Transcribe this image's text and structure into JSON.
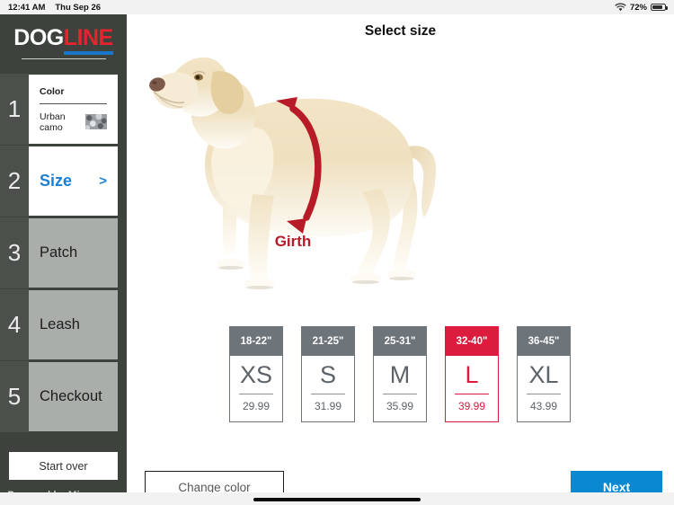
{
  "statusbar": {
    "time": "12:41 AM",
    "date": "Thu Sep 26",
    "battery_percent": "72%",
    "wifi_icon": "wifi-icon",
    "battery_icon": "battery-icon"
  },
  "brand": {
    "logo_part1": "DOG",
    "logo_part2": "LINE",
    "footer": "Powered by Microzone"
  },
  "sidebar": {
    "start_over_label": "Start over",
    "steps": [
      {
        "number": "1",
        "state": "done",
        "label": "Color",
        "value": "Urban camo",
        "swatch": "urban-camo-swatch"
      },
      {
        "number": "2",
        "state": "active",
        "label": "Size",
        "chevron": ">"
      },
      {
        "number": "3",
        "state": "todo",
        "label": "Patch"
      },
      {
        "number": "4",
        "state": "todo",
        "label": "Leash"
      },
      {
        "number": "5",
        "state": "todo",
        "label": "Checkout"
      }
    ]
  },
  "main": {
    "title": "Select size",
    "hero": {
      "image_alt": "yellow-labrador-side-view",
      "measure_label": "Girth",
      "measure_arrow": "girth-arrow-icon"
    },
    "sizes": [
      {
        "range": "18-22\"",
        "code": "XS",
        "price": "29.99",
        "selected": false
      },
      {
        "range": "21-25\"",
        "code": "S",
        "price": "31.99",
        "selected": false
      },
      {
        "range": "25-31\"",
        "code": "M",
        "price": "35.99",
        "selected": false
      },
      {
        "range": "32-40\"",
        "code": "L",
        "price": "39.99",
        "selected": true
      },
      {
        "range": "36-45\"",
        "code": "XL",
        "price": "43.99",
        "selected": false
      }
    ],
    "change_color_label": "Change color",
    "next_label": "Next"
  },
  "colors": {
    "selected_red": "#dc1c3f",
    "accent_blue": "#0a88d0",
    "logo_red": "#e8232f",
    "logo_blue": "#1877c9",
    "sidebar_bg": "#3d423d",
    "card_gray": "#6e757a",
    "girth_red": "#b81b28"
  }
}
